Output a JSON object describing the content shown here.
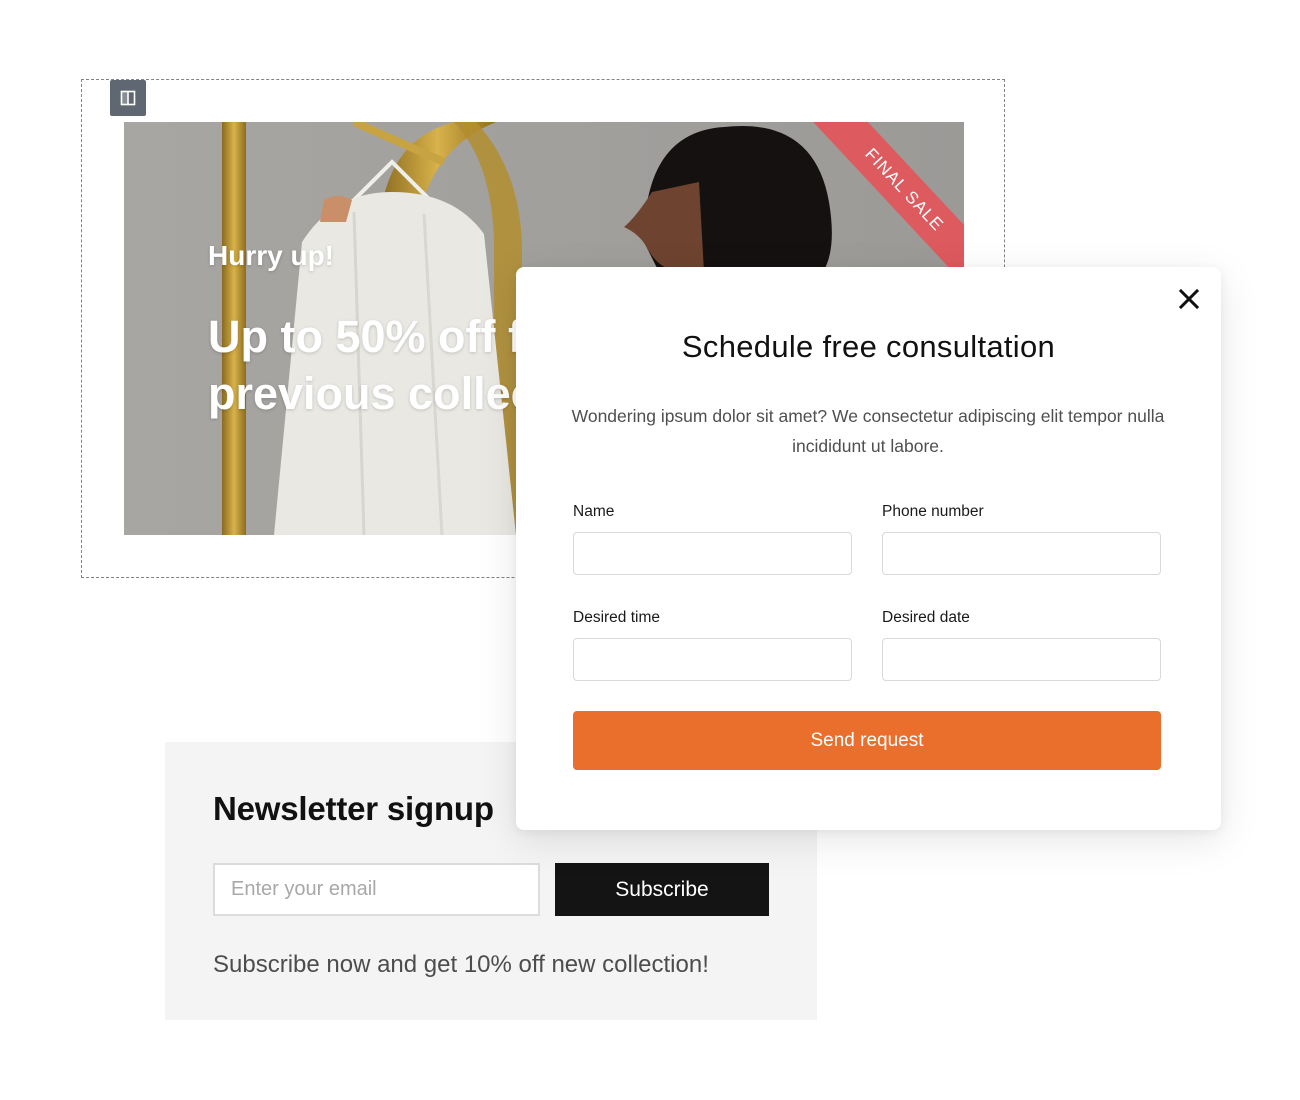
{
  "banner": {
    "eyebrow": "Hurry up!",
    "headline": "Up to 50% off f\nprevious collec",
    "ribbon": "FINAL SALE",
    "layout_icon": "columns-layout-icon"
  },
  "newsletter": {
    "title": "Newsletter signup",
    "email_placeholder": "Enter your email",
    "subscribe_label": "Subscribe",
    "note": "Subscribe now and get 10% off new collection!"
  },
  "modal": {
    "close_icon": "close-icon",
    "title": "Schedule free consultation",
    "description": "Wondering ipsum dolor sit amet? We consectetur adipiscing elit tempor nulla incididunt ut labore.",
    "fields": {
      "name_label": "Name",
      "phone_label": "Phone number",
      "time_label": "Desired time",
      "date_label": "Desired date"
    },
    "submit_label": "Send request"
  },
  "colors": {
    "accent_orange": "#ea6f2d",
    "ribbon_red": "#dd5a5e",
    "subscribe_black": "#141414"
  }
}
